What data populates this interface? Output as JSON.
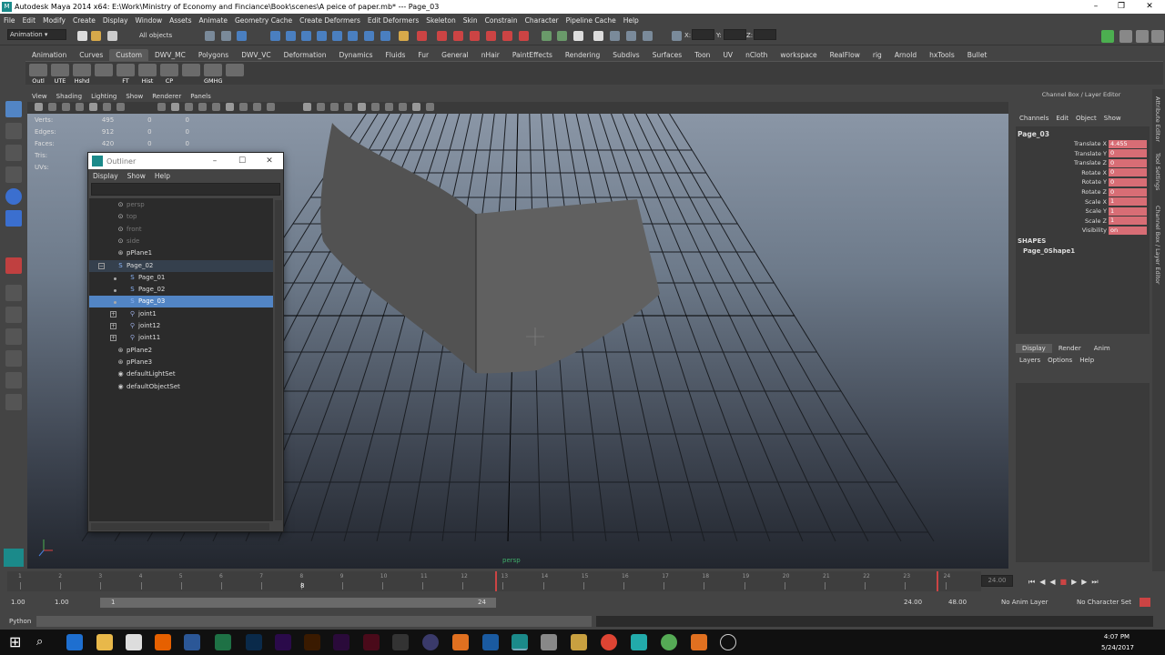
{
  "window": {
    "title": "Autodesk Maya 2014 x64: E:\\Work\\Ministry of Economy and Finciance\\Book\\scenes\\A peice of paper.mb*  ---  Page_03"
  },
  "menubar": [
    "File",
    "Edit",
    "Modify",
    "Create",
    "Display",
    "Window",
    "Assets",
    "Animate",
    "Geometry Cache",
    "Create Deformers",
    "Edit Deformers",
    "Skeleton",
    "Skin",
    "Constrain",
    "Character",
    "Pipeline Cache",
    "Help"
  ],
  "statusline": {
    "mode": "Animation",
    "selection_label": "All objects",
    "x_label": "X:",
    "y_label": "Y:",
    "z_label": "Z:"
  },
  "shelf_tabs": [
    "Animation",
    "Curves",
    "Custom",
    "DWV_MC",
    "Polygons",
    "DWV_VC",
    "Deformation",
    "Dynamics",
    "Fluids",
    "Fur",
    "General",
    "nHair",
    "PaintEffects",
    "Rendering",
    "Subdivs",
    "Surfaces",
    "Toon",
    "UV",
    "nCloth",
    "workspace",
    "RealFlow",
    "rig",
    "Arnold",
    "hxTools",
    "Bullet"
  ],
  "shelf_active": "Custom",
  "shelf_buttons": [
    "Outl",
    "UTE",
    "Hshd",
    "",
    "FT",
    "Hist",
    "CP",
    "",
    "GMHG",
    ""
  ],
  "panel_menu": [
    "View",
    "Shading",
    "Lighting",
    "Show",
    "Renderer",
    "Panels"
  ],
  "hud": [
    {
      "label": "Verts:",
      "values": [
        "495",
        "0",
        "0"
      ]
    },
    {
      "label": "Edges:",
      "values": [
        "912",
        "0",
        "0"
      ]
    },
    {
      "label": "Faces:",
      "values": [
        "420",
        "0",
        "0"
      ]
    },
    {
      "label": "Tris:",
      "values": [
        "",
        "",
        ""
      ]
    },
    {
      "label": "UVs:",
      "values": [
        "",
        "",
        ""
      ]
    }
  ],
  "viewport_camera_label": "persp",
  "outliner": {
    "title": "Outliner",
    "menu": [
      "Display",
      "Show",
      "Help"
    ],
    "nodes": [
      {
        "label": "persp",
        "dim": true,
        "indent": 0,
        "icon": "camera"
      },
      {
        "label": "top",
        "dim": true,
        "indent": 0,
        "icon": "camera"
      },
      {
        "label": "front",
        "dim": true,
        "indent": 0,
        "icon": "camera"
      },
      {
        "label": "side",
        "dim": true,
        "indent": 0,
        "icon": "camera"
      },
      {
        "label": "pPlane1",
        "indent": 0,
        "icon": "mesh"
      },
      {
        "label": "Page_02",
        "indent": 0,
        "icon": "curve",
        "group": true,
        "expander": "−"
      },
      {
        "label": "Page_01",
        "indent": 1,
        "icon": "curve"
      },
      {
        "label": "Page_02",
        "indent": 1,
        "icon": "curve"
      },
      {
        "label": "Page_03",
        "indent": 1,
        "icon": "curve",
        "selected": true
      },
      {
        "label": "joint1",
        "indent": 1,
        "icon": "joint",
        "expander": "+"
      },
      {
        "label": "joint12",
        "indent": 1,
        "icon": "joint",
        "expander": "+"
      },
      {
        "label": "joint11",
        "indent": 1,
        "icon": "joint",
        "expander": "+"
      },
      {
        "label": "pPlane2",
        "indent": 0,
        "icon": "mesh"
      },
      {
        "label": "pPlane3",
        "indent": 0,
        "icon": "mesh"
      },
      {
        "label": "defaultLightSet",
        "indent": 0,
        "icon": "set"
      },
      {
        "label": "defaultObjectSet",
        "indent": 0,
        "icon": "set"
      }
    ]
  },
  "channel_box": {
    "header": "Channel Box / Layer Editor",
    "menu": [
      "Channels",
      "Edit",
      "Object",
      "Show"
    ],
    "object": "Page_03",
    "attrs": [
      {
        "name": "Translate X",
        "value": "4.455"
      },
      {
        "name": "Translate Y",
        "value": "0"
      },
      {
        "name": "Translate Z",
        "value": "0"
      },
      {
        "name": "Rotate X",
        "value": "0"
      },
      {
        "name": "Rotate Y",
        "value": "0"
      },
      {
        "name": "Rotate Z",
        "value": "0"
      },
      {
        "name": "Scale X",
        "value": "1"
      },
      {
        "name": "Scale Y",
        "value": "1"
      },
      {
        "name": "Scale Z",
        "value": "1"
      },
      {
        "name": "Visibility",
        "value": "on"
      }
    ],
    "shapes_label": "SHAPES",
    "shape_name": "Page_0Shape1"
  },
  "layer_editor": {
    "tabs": [
      "Display",
      "Render",
      "Anim"
    ],
    "active": "Display",
    "menu": [
      "Layers",
      "Options",
      "Help"
    ]
  },
  "side_tabs": [
    "Attribute Editor",
    "Tool Settings",
    "Channel Box / Layer Editor"
  ],
  "timeline": {
    "ticks": [
      "1",
      "2",
      "3",
      "4",
      "5",
      "6",
      "7",
      "8",
      "9",
      "10",
      "11",
      "12",
      "13",
      "14",
      "15",
      "16",
      "17",
      "18",
      "19",
      "20",
      "21",
      "22",
      "23",
      "24"
    ],
    "current_frame": "8",
    "current_display": "24.00"
  },
  "range": {
    "start": "1.00",
    "start2": "1.00",
    "range_start": "1",
    "range_end": "24",
    "end": "24.00",
    "end2": "48.00",
    "anim_layer": "No Anim Layer",
    "character": "No Character Set"
  },
  "cmdline": {
    "label": "Python"
  },
  "taskbar": {
    "time": "4:07 PM",
    "date": "5/24/2017"
  }
}
